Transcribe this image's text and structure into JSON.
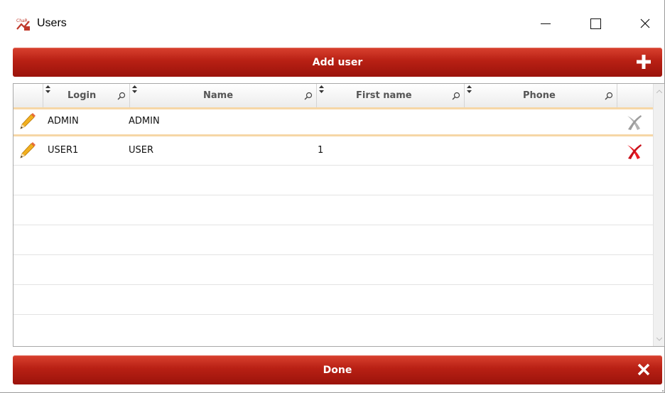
{
  "window": {
    "title": "Users",
    "app_icon": "chart-app-icon",
    "controls": [
      "minimize-icon",
      "maximize-icon",
      "close-icon"
    ]
  },
  "add_bar": {
    "label": "Add user",
    "icon": "plus-icon"
  },
  "grid": {
    "columns": [
      {
        "label": "",
        "key": "edit"
      },
      {
        "label": "Login",
        "key": "login"
      },
      {
        "label": "Name",
        "key": "name"
      },
      {
        "label": "First name",
        "key": "first_name"
      },
      {
        "label": "Phone",
        "key": "phone"
      },
      {
        "label": "",
        "key": "delete"
      }
    ],
    "rows": [
      {
        "login": "ADMIN",
        "name": "ADMIN",
        "first_name": "",
        "phone": "",
        "delete_enabled": false,
        "selected": true
      },
      {
        "login": "USER1",
        "name": "USER",
        "first_name": "1",
        "phone": "",
        "delete_enabled": true,
        "selected": false
      }
    ],
    "empty_rows": 6
  },
  "done_bar": {
    "label": "Done",
    "icon": "close-icon"
  },
  "colors": {
    "accent_red": "#b82014",
    "delete_active": "#e0101a",
    "delete_inactive": "#a9a9a9",
    "selected_row_border": "#f6d7a6"
  }
}
